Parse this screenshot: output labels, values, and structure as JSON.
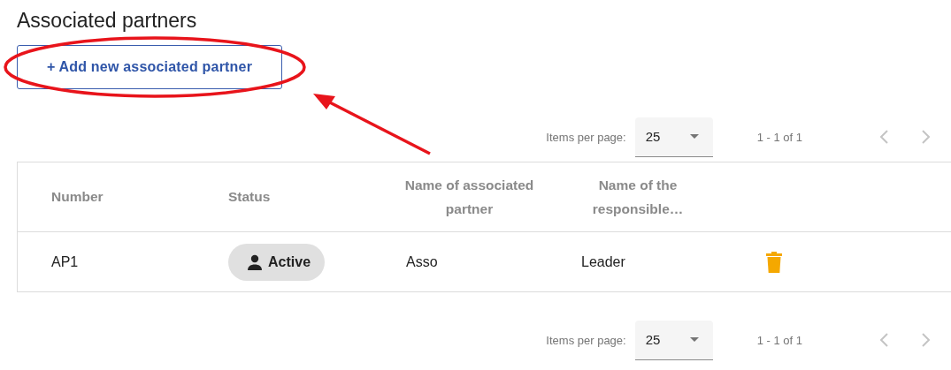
{
  "title": "Associated partners",
  "add_button": {
    "label": "+ Add new associated partner"
  },
  "paginators": [
    {
      "label": "Items per page:",
      "page_size": "25",
      "range": "1 - 1 of 1",
      "prev_disabled": true,
      "next_disabled": true
    },
    {
      "label": "Items per page:",
      "page_size": "25",
      "range": "1 - 1 of 1",
      "prev_disabled": true,
      "next_disabled": true
    }
  ],
  "table": {
    "columns": [
      "Number",
      "Status",
      "Name of associated partner",
      "Name of the responsible…"
    ],
    "rows": [
      {
        "number": "AP1",
        "status": "Active",
        "name": "Asso",
        "responsible": "Leader"
      }
    ]
  }
}
